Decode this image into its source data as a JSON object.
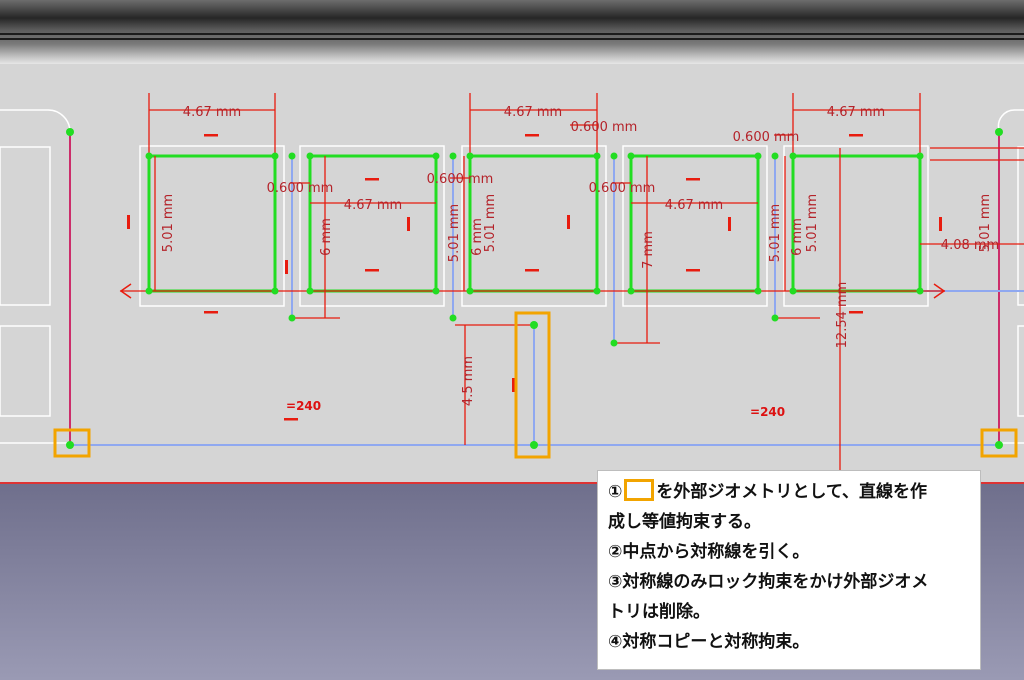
{
  "dimensions": {
    "width_top": "4.67 mm",
    "height_main": "5.01 mm",
    "offset_small": "0.600 mm",
    "height_six": "6 mm",
    "height_seven": "7 mm",
    "distance_right": "4.08 mm",
    "height_total": "12.54 mm",
    "distance_bottom": "4.5 mm"
  },
  "constraints": {
    "equal_left": "240",
    "equal_right": "240"
  },
  "instructions": {
    "step1_a": "①",
    "step1_b": "を外部ジオメトリとして、直線を作",
    "step1_c": "成し等値拘束する。",
    "step2": "②中点から対称線を引く。",
    "step3_a": "③対称線のみロック拘束をかけ外部ジオメ",
    "step3_b": "トリは削除。",
    "step4": "④対称コピーと対称拘束。"
  },
  "colors": {
    "sketch_green": "#22dd22",
    "dimension_red": "#e81c0f",
    "highlight_orange": "#f2a400",
    "construction_blue": "#8fa8f0",
    "line_magenta": "#cc2d6a"
  }
}
